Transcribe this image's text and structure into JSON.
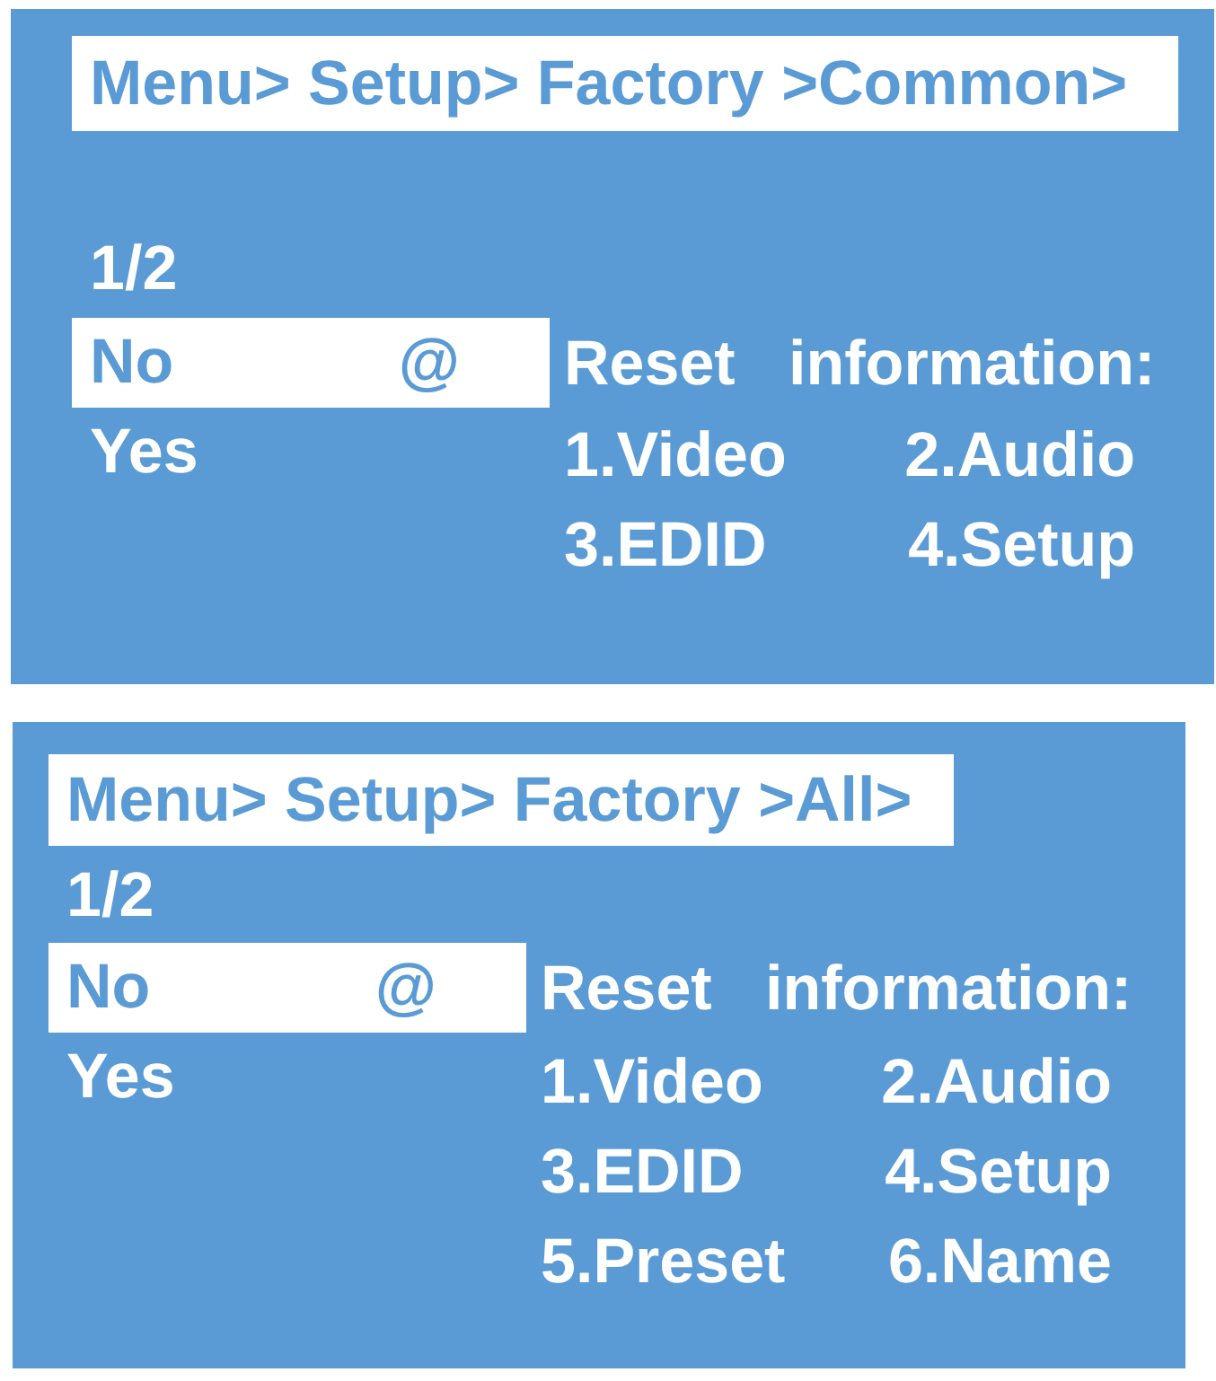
{
  "screens": [
    {
      "breadcrumb": "Menu> Setup> Factory >Common>",
      "page": "1/2",
      "options": [
        {
          "label": "No",
          "marker": "@",
          "selected": true
        },
        {
          "label": "Yes",
          "selected": false
        }
      ],
      "info_title": "Reset information:",
      "info_items": [
        "1.Video",
        "2.Audio",
        "3.EDID",
        "4.Setup"
      ]
    },
    {
      "breadcrumb": "Menu> Setup> Factory >All>",
      "page": "1/2",
      "options": [
        {
          "label": "No",
          "marker": "@",
          "selected": true
        },
        {
          "label": "Yes",
          "selected": false
        }
      ],
      "info_title": "Reset information:",
      "info_items": [
        "1.Video",
        "2.Audio",
        "3.EDID",
        "4.Setup",
        "5.Preset",
        "6.Name"
      ]
    }
  ]
}
